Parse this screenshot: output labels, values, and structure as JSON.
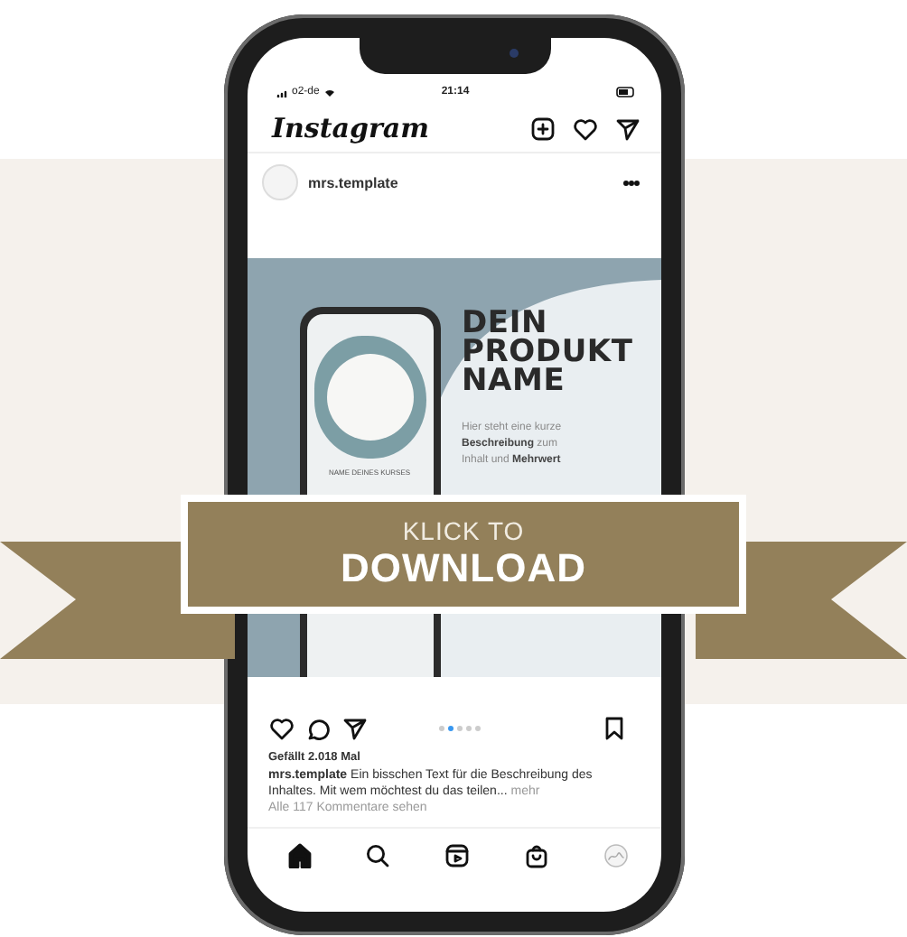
{
  "status_bar": {
    "carrier": "o2-de",
    "time": "21:14"
  },
  "app_bar": {
    "logo": "Instagram"
  },
  "post": {
    "username": "mrs.template",
    "image": {
      "headline": "DEIN PRODUKT NAME",
      "description": "Hier steht eine kurze\n**Beschreibung** zum\nInhalt und **Mehrwert**",
      "inner_caption": "NAME DEINES KURSES"
    },
    "carousel_dots": [
      {
        "selected": false
      },
      {
        "selected": true
      },
      {
        "selected": false
      },
      {
        "selected": false
      },
      {
        "selected": false
      }
    ],
    "likes": "Gefällt 2.018 Mal",
    "caption": "**mrs.template** Ein bisschen Text für die Beschreibung des Inhaltes. Mit wem möchtest du das teilen...",
    "more": "mehr",
    "comments_link": "Alle 117 Kommentare sehen"
  },
  "nav": [
    {
      "kind": "home",
      "selected": true
    },
    {
      "kind": "search",
      "selected": false
    },
    {
      "kind": "reels",
      "selected": false
    },
    {
      "kind": "shop",
      "selected": false
    },
    {
      "kind": "profile",
      "selected": false
    }
  ],
  "banner": {
    "line1": "KLICK TO",
    "line2": "DOWNLOAD"
  }
}
